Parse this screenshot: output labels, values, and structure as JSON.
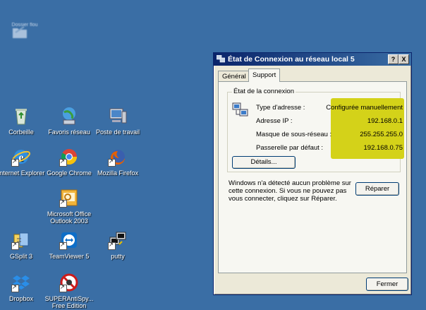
{
  "desktop": {
    "blurred_label": "Dossier flou",
    "icons": [
      {
        "label": "Corbeille"
      },
      {
        "label": "Favoris réseau"
      },
      {
        "label": "Poste de travail"
      },
      {
        "label": "Internet Explorer"
      },
      {
        "label": "Google Chrome"
      },
      {
        "label": "Mozilla Firefox"
      },
      {
        "label": "Microsoft Office Outlook 2003"
      },
      {
        "label": "GSplit 3"
      },
      {
        "label": "TeamViewer 5"
      },
      {
        "label": "putty"
      },
      {
        "label": "Dropbox"
      },
      {
        "label": "SUPERAntiSpy... Free Edition"
      }
    ]
  },
  "dialog": {
    "title": "État de Connexion au réseau local 5",
    "help_button": "?",
    "close_button": "X",
    "tabs": [
      {
        "label": "Général"
      },
      {
        "label": "Support"
      }
    ],
    "active_tab": "Support",
    "group_title": "État de la connexion",
    "rows": [
      {
        "label": "Type d'adresse :",
        "value": "Configurée manuellement"
      },
      {
        "label": "Adresse IP :",
        "value": "192.168.0.1"
      },
      {
        "label": "Masque de sous-réseau :",
        "value": "255.255.255.0"
      },
      {
        "label": "Passerelle par défaut :",
        "value": "192.168.0.75"
      }
    ],
    "details_button": "Détails...",
    "message": "Windows n'a détecté aucun problème sur cette connexion. Si vous ne pouvez pas vous connecter, cliquez sur Réparer.",
    "repair_button": "Réparer",
    "close_label": "Fermer",
    "highlight_color": "#d4d219"
  }
}
